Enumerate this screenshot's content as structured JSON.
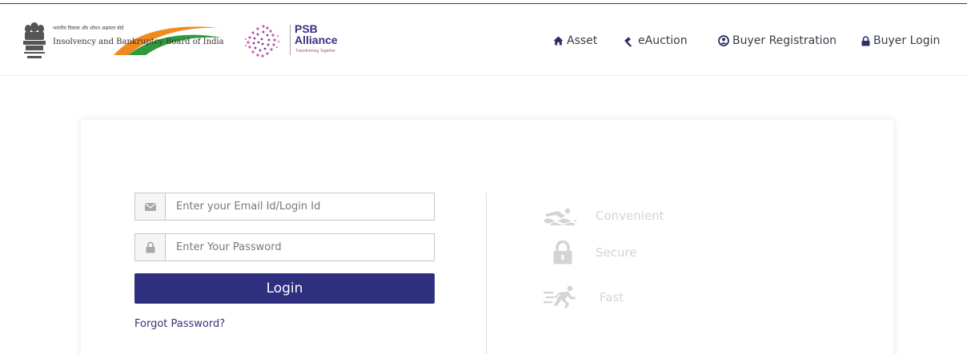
{
  "header": {
    "ibbi_logo": {
      "hindi_text": "भारतीय दिवाला और शोधन अक्षमता बोर्ड",
      "name": "Insolvency and Bankruptcy Board of India",
      "brand_colors": {
        "saffron": "#f08a1c",
        "green": "#2f9a3b"
      }
    },
    "psb_logo": {
      "title_line1": "PSB",
      "title_line2": "Alliance",
      "tagline": "Transforming Together",
      "brand_color": "#3a2f82"
    },
    "nav": [
      {
        "label": "Asset",
        "icon": "home-icon"
      },
      {
        "label": "eAuction",
        "icon": "gavel-icon"
      },
      {
        "label": "Buyer Registration",
        "icon": "user-circle-icon"
      },
      {
        "label": "Buyer Login",
        "icon": "lock-icon"
      }
    ]
  },
  "login": {
    "email_placeholder": "Enter your Email Id/Login Id",
    "email_value": "",
    "password_placeholder": "Enter Your Password",
    "password_value": "",
    "login_label": "Login",
    "forgot_label": "Forgot Password?",
    "button_color": "#2e2f7e"
  },
  "features": [
    {
      "label": "Convenient",
      "icon": "swimmer-icon"
    },
    {
      "label": "Secure",
      "icon": "lock-icon"
    },
    {
      "label": "Fast",
      "icon": "runner-icon"
    }
  ]
}
